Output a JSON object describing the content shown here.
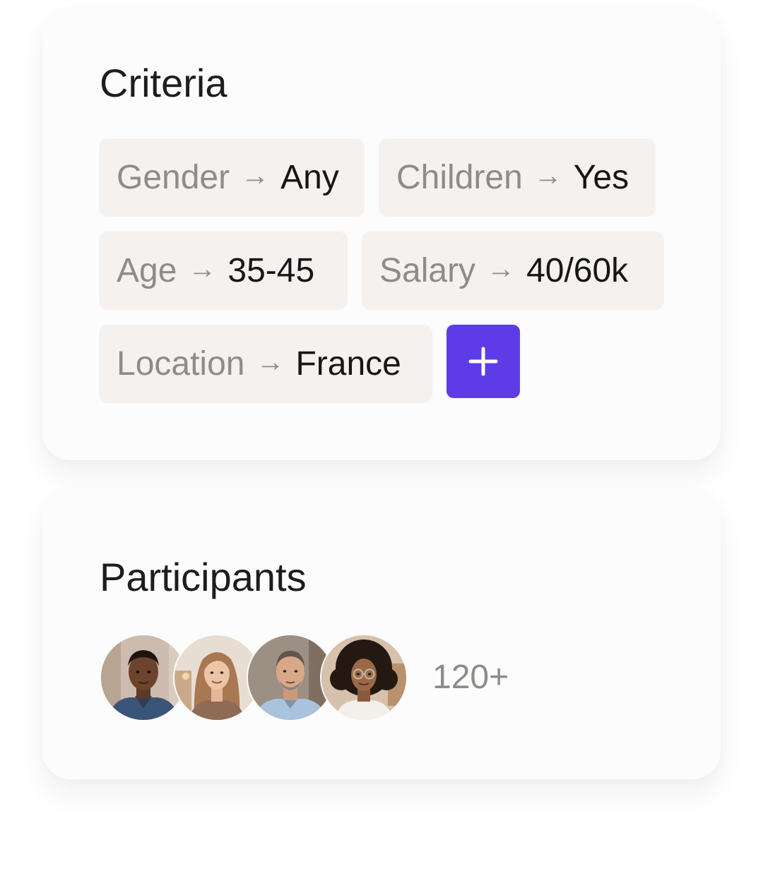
{
  "criteria": {
    "title": "Criteria",
    "arrow": "→",
    "chips": [
      {
        "key": "Gender",
        "value": "Any"
      },
      {
        "key": "Children",
        "value": "Yes"
      },
      {
        "key": "Age",
        "value": "35-45"
      },
      {
        "key": "Salary",
        "value": "40/60k"
      },
      {
        "key": "Location",
        "value": "France"
      }
    ],
    "add_icon": "plus-icon"
  },
  "participants": {
    "title": "Participants",
    "count": "120+",
    "avatars": [
      "avatar-man-dark-hair",
      "avatar-woman-long-hair",
      "avatar-man-grey-hair",
      "avatar-woman-curly-hair-glasses"
    ]
  },
  "colors": {
    "accent": "#5d3ce8",
    "chip_bg": "#f5f1ee",
    "muted_text": "#8f8b88",
    "strong_text": "#161616"
  }
}
